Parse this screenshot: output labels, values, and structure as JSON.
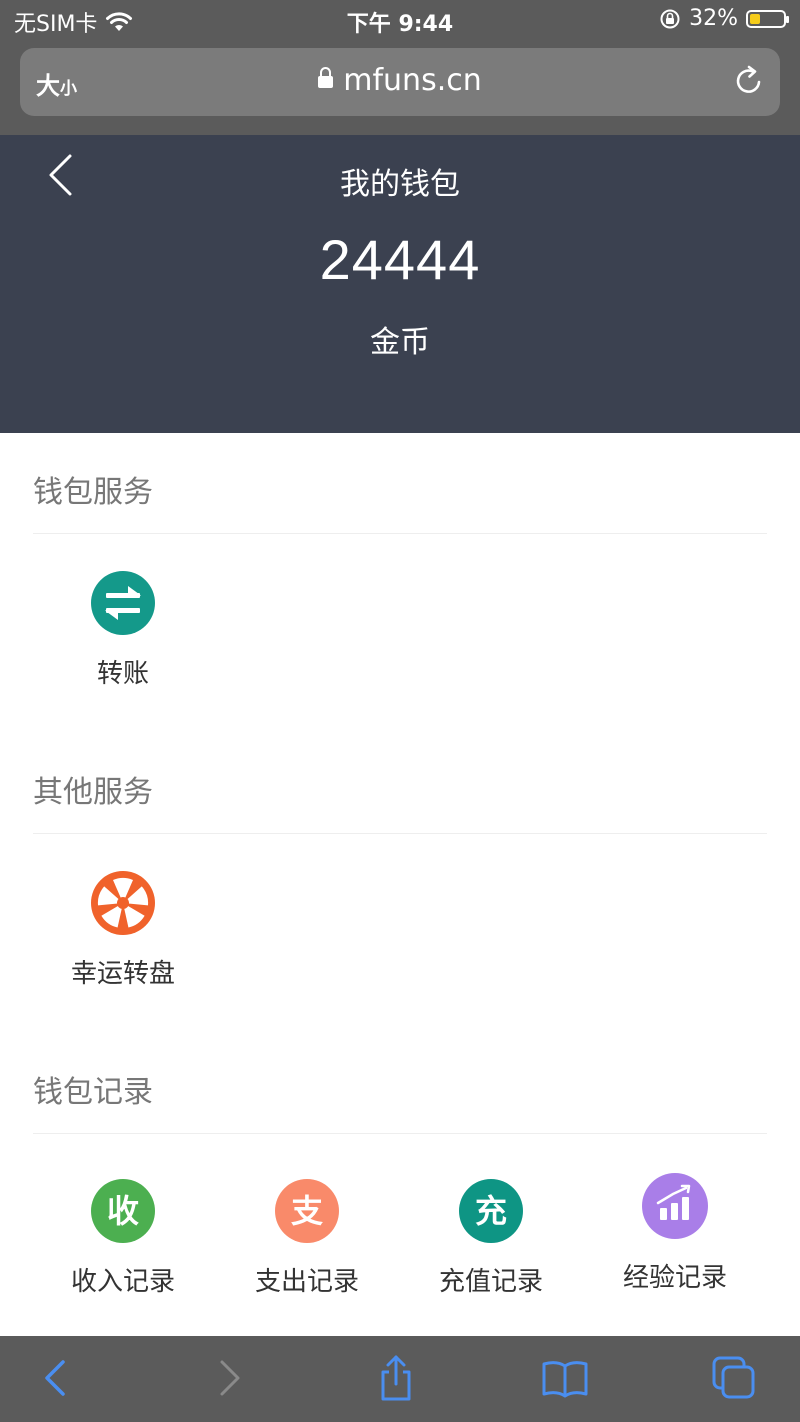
{
  "status_bar": {
    "carrier": "无SIM卡",
    "time": "下午 9:44",
    "battery_text": "32%",
    "battery_level": 0.32
  },
  "browser": {
    "text_size_label": "大",
    "text_size_small": "小",
    "url": "mfuns.cn"
  },
  "header": {
    "title": "我的钱包",
    "balance": "24444",
    "unit": "金币"
  },
  "sections": {
    "wallet_services": {
      "title": "钱包服务",
      "items": [
        {
          "label": "转账",
          "color": "#14998a",
          "icon": "transfer-icon"
        }
      ]
    },
    "other_services": {
      "title": "其他服务",
      "items": [
        {
          "label": "幸运转盘",
          "color": "#f0622b",
          "icon": "lucky-wheel-icon"
        }
      ]
    },
    "wallet_records": {
      "title": "钱包记录",
      "items": [
        {
          "label": "收入记录",
          "glyph": "收",
          "color": "#4caf50",
          "icon": "income-icon"
        },
        {
          "label": "支出记录",
          "glyph": "支",
          "color": "#f98a6a",
          "icon": "expense-icon"
        },
        {
          "label": "充值记录",
          "glyph": "充",
          "color": "#0e9584",
          "icon": "recharge-icon"
        },
        {
          "label": "经验记录",
          "color": "#a97ee8",
          "icon": "experience-chart-icon"
        }
      ]
    }
  },
  "toolbar": {
    "items": [
      "back-arrow-icon",
      "forward-arrow-icon",
      "share-icon",
      "bookmarks-icon",
      "tabs-icon"
    ],
    "accent": "#4a8ef0"
  }
}
